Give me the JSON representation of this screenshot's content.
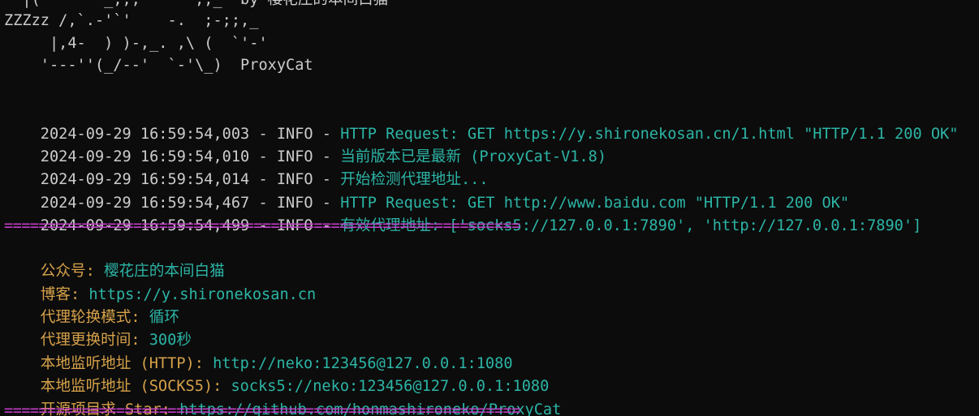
{
  "banner": {
    "line_top": "  |(       _,,,      ,,_  by 樱花庄的本间白猫",
    "line1": "ZZZzz /,`.-'`'    -.  ;-;;,_",
    "line2": "     |,4-  ) )-,_. ,\\ (  `'-'",
    "line3": "    '---''(_/--'  `-'\\_)  ProxyCat"
  },
  "logs": [
    {
      "prefix": "2024-09-29 16:59:54,003 - INFO - ",
      "message": "HTTP Request: GET https://y.shironekosan.cn/1.html \"HTTP/1.1 200 OK\""
    },
    {
      "prefix": "2024-09-29 16:59:54,010 - INFO - ",
      "message": "当前版本已是最新 (ProxyCat-V1.8)"
    },
    {
      "prefix": "2024-09-29 16:59:54,014 - INFO - ",
      "message": "开始检测代理地址..."
    },
    {
      "prefix": "2024-09-29 16:59:54,467 - INFO - ",
      "message": "HTTP Request: GET http://www.baidu.com \"HTTP/1.1 200 OK\""
    },
    {
      "prefix": "2024-09-29 16:59:54,499 - INFO - ",
      "message": "有效代理地址: ['socks5://127.0.0.1:7890', 'http://127.0.0.1:7890']"
    }
  ],
  "separator": "============================================================",
  "info": [
    {
      "key": "公众号: ",
      "value": "樱花庄的本间白猫"
    },
    {
      "key": "博客: ",
      "value": "https://y.shironekosan.cn"
    },
    {
      "key": "代理轮换模式: ",
      "value": "循环"
    },
    {
      "key": "代理更换时间: ",
      "value": "300秒"
    },
    {
      "key": "本地监听地址 (HTTP): ",
      "value": "http://neko:123456@127.0.0.1:1080"
    },
    {
      "key": "本地监听地址 (SOCKS5): ",
      "value": "socks5://neko:123456@127.0.0.1:1080"
    },
    {
      "key": "开源项目求 Star: ",
      "value": "https://github.com/honmashironeko/ProxyCat"
    }
  ],
  "colors": {
    "background": "#0c0c0c",
    "text": "#cccccc",
    "message": "#2cb5a6",
    "key": "#d7a24a",
    "separator": "#c23ec9"
  }
}
